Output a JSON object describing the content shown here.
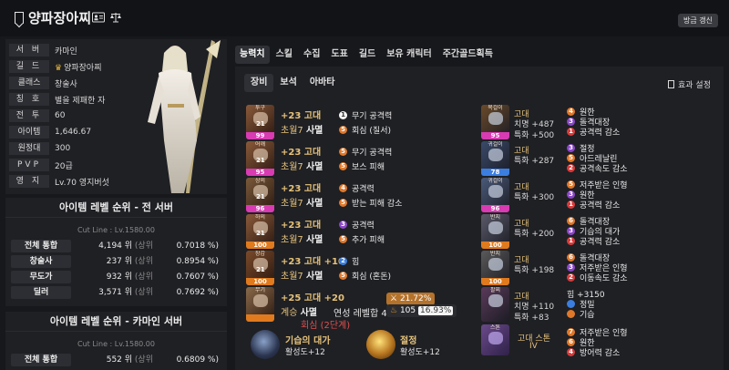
{
  "header": {
    "character_name": "양파장아찌",
    "update_label": "방금 갱신",
    "icons": [
      "bookmark-icon",
      "id-card-icon",
      "scale-icon"
    ]
  },
  "profile": {
    "rows": [
      {
        "key": "서 버",
        "value": "카마인"
      },
      {
        "key": "길 드",
        "value": "양파장아찌"
      },
      {
        "key": "클래스",
        "value": "창술사"
      },
      {
        "key": "칭 호",
        "value": "별을 제패한 자"
      },
      {
        "key": "전 투",
        "value": "60"
      },
      {
        "key": "아이템",
        "value": "1,646.67"
      },
      {
        "key": "원정대",
        "value": "300"
      },
      {
        "key": "PVP",
        "value": "20급"
      },
      {
        "key": "영 지",
        "value": "Lv.70 영지버섯"
      }
    ]
  },
  "rank_all": {
    "title": "아이템 레벨 순위 - 전 서버",
    "cutline": "Cut Line : Lv.1580.00",
    "rows": [
      {
        "label": "전체 통합",
        "rank": "4,194 위",
        "top": "(상위",
        "pct": "0.7018 %)"
      },
      {
        "label": "창술사",
        "rank": "237 위",
        "top": "(상위",
        "pct": "0.8954 %)"
      },
      {
        "label": "무도가",
        "rank": "932 위",
        "top": "(상위",
        "pct": "0.7607 %)"
      },
      {
        "label": "딜러",
        "rank": "3,571 위",
        "top": "(상위",
        "pct": "0.7692 %)"
      }
    ]
  },
  "rank_server": {
    "title": "아이템 레벨 순위 - 카마인 서버",
    "cutline": "Cut Line : Lv.1580.00",
    "rows": [
      {
        "label": "전체 통합",
        "rank": "552 위",
        "top": "(상위",
        "pct": "0.6809 %)"
      }
    ]
  },
  "tabs": [
    "능력치",
    "스킬",
    "수집",
    "도표",
    "길드",
    "보유 캐릭터",
    "주간골드획득"
  ],
  "subtabs": [
    "장비",
    "보석",
    "아바타"
  ],
  "effect_settings_label": "효과 설정",
  "equipment": [
    {
      "slot": "투구",
      "num": "21",
      "quality": "99",
      "quality_color": "#d83bb2",
      "line1": "+23 고대",
      "tier": "초월7",
      "set": "사멸",
      "effects": [
        {
          "n": "1",
          "c": "d-white",
          "t": "무기 공격력"
        },
        {
          "n": "5",
          "c": "d-orange",
          "t": "회심 (질서)"
        }
      ]
    },
    {
      "slot": "어깨",
      "num": "21",
      "quality": "95",
      "quality_color": "#d83bb2",
      "line1": "+23 고대",
      "tier": "초월7",
      "set": "사멸",
      "effects": [
        {
          "n": "5",
          "c": "d-orange",
          "t": "무기 공격력"
        },
        {
          "n": "5",
          "c": "d-orange",
          "t": "보스 피해"
        }
      ]
    },
    {
      "slot": "상의",
      "num": "21",
      "quality": "96",
      "quality_color": "#d83bb2",
      "line1": "+23 고대",
      "tier": "초월7",
      "set": "사멸",
      "effects": [
        {
          "n": "4",
          "c": "d-orange",
          "t": "공격력"
        },
        {
          "n": "5",
          "c": "d-orange",
          "t": "받는 피해 감소"
        }
      ]
    },
    {
      "slot": "하의",
      "num": "21",
      "quality": "100",
      "quality_color": "#e07a1e",
      "line1": "+23 고대",
      "tier": "초월7",
      "set": "사멸",
      "effects": [
        {
          "n": "3",
          "c": "d-purple",
          "t": "공격력"
        },
        {
          "n": "5",
          "c": "d-orange",
          "t": "추가 피해"
        }
      ]
    },
    {
      "slot": "장갑",
      "num": "21",
      "quality": "100",
      "quality_color": "#e07a1e",
      "line1": "+23 고대 +10",
      "tier": "초월7",
      "set": "사멸",
      "effects": [
        {
          "n": "2",
          "c": "d-blue",
          "t": "힘"
        },
        {
          "n": "5",
          "c": "d-orange",
          "t": "회심 (혼돈)"
        }
      ]
    },
    {
      "slot": "무기",
      "num": "",
      "quality": "",
      "quality_color": "#e07a1e",
      "line1": "+25 고대 +20",
      "tier": "계승",
      "set": "사멸",
      "effects": []
    }
  ],
  "weapon_extra": {
    "elixir_label": "회심 (2단계)",
    "elixir_pct": "21.72%",
    "transcend_label": "연성 레벨합 40",
    "transcend_value": "105",
    "transcend_pct": "16.93%"
  },
  "accessories": [
    {
      "slot": "목걸이",
      "quality": "95",
      "quality_color": "#d83bb2",
      "grade": "고대",
      "stats": [
        "치명 +487",
        "특화 +500"
      ],
      "effects": [
        {
          "n": "4",
          "c": "d-orange",
          "t": "원한"
        },
        {
          "n": "3",
          "c": "d-purple",
          "t": "돌격대장"
        },
        {
          "n": "1",
          "c": "d-red",
          "t": "공격력 감소"
        }
      ]
    },
    {
      "slot": "귀걸이",
      "quality": "78",
      "quality_color": "#3b7ee0",
      "grade": "고대",
      "stats": [
        "특화 +287"
      ],
      "effects": [
        {
          "n": "3",
          "c": "d-purple",
          "t": "절정"
        },
        {
          "n": "5",
          "c": "d-orange",
          "t": "아드레날린"
        },
        {
          "n": "2",
          "c": "d-red",
          "t": "공격속도 감소"
        }
      ]
    },
    {
      "slot": "귀걸이",
      "quality": "96",
      "quality_color": "#d83bb2",
      "grade": "고대",
      "stats": [
        "특화 +300"
      ],
      "effects": [
        {
          "n": "5",
          "c": "d-orange",
          "t": "저주받은 인형"
        },
        {
          "n": "3",
          "c": "d-purple",
          "t": "원한"
        },
        {
          "n": "1",
          "c": "d-red",
          "t": "공격력 감소"
        }
      ]
    },
    {
      "slot": "반지",
      "quality": "100",
      "quality_color": "#e07a1e",
      "grade": "고대",
      "stats": [
        "특화 +200"
      ],
      "effects": [
        {
          "n": "6",
          "c": "d-orange",
          "t": "돌격대장"
        },
        {
          "n": "3",
          "c": "d-purple",
          "t": "기습의 대가"
        },
        {
          "n": "1",
          "c": "d-red",
          "t": "공격력 감소"
        }
      ]
    },
    {
      "slot": "반지",
      "quality": "100",
      "quality_color": "#e07a1e",
      "grade": "고대",
      "stats": [
        "특화 +198"
      ],
      "effects": [
        {
          "n": "6",
          "c": "d-orange",
          "t": "돌격대장"
        },
        {
          "n": "3",
          "c": "d-purple",
          "t": "저주받은 인형"
        },
        {
          "n": "2",
          "c": "d-red",
          "t": "이동속도 감소"
        }
      ]
    },
    {
      "slot": "팔찌",
      "quality": "",
      "quality_color": "#e07a1e",
      "grade": "고대",
      "stats": [
        "치명 +110",
        "특화 +83"
      ],
      "effects": [
        {
          "n": "",
          "c": "",
          "t": "힘 +3150"
        },
        {
          "n": "",
          "c": "d-blue",
          "t": "정밀"
        },
        {
          "n": "",
          "c": "d-orange",
          "t": "기습"
        }
      ]
    }
  ],
  "engravings": [
    {
      "name": "기습의 대가",
      "sub": "활성도+12",
      "icon": "ambush-icon"
    },
    {
      "name": "절정",
      "sub": "활성도+12",
      "icon": "climax-icon"
    }
  ],
  "stone": {
    "slot": "스톤",
    "grade": "고대 스톤",
    "level": "IV",
    "effects": [
      {
        "n": "7",
        "c": "d-orange",
        "t": "저주받은 인형"
      },
      {
        "n": "6",
        "c": "d-orange",
        "t": "원한"
      },
      {
        "n": "4",
        "c": "d-red",
        "t": "방어력 감소"
      }
    ]
  }
}
